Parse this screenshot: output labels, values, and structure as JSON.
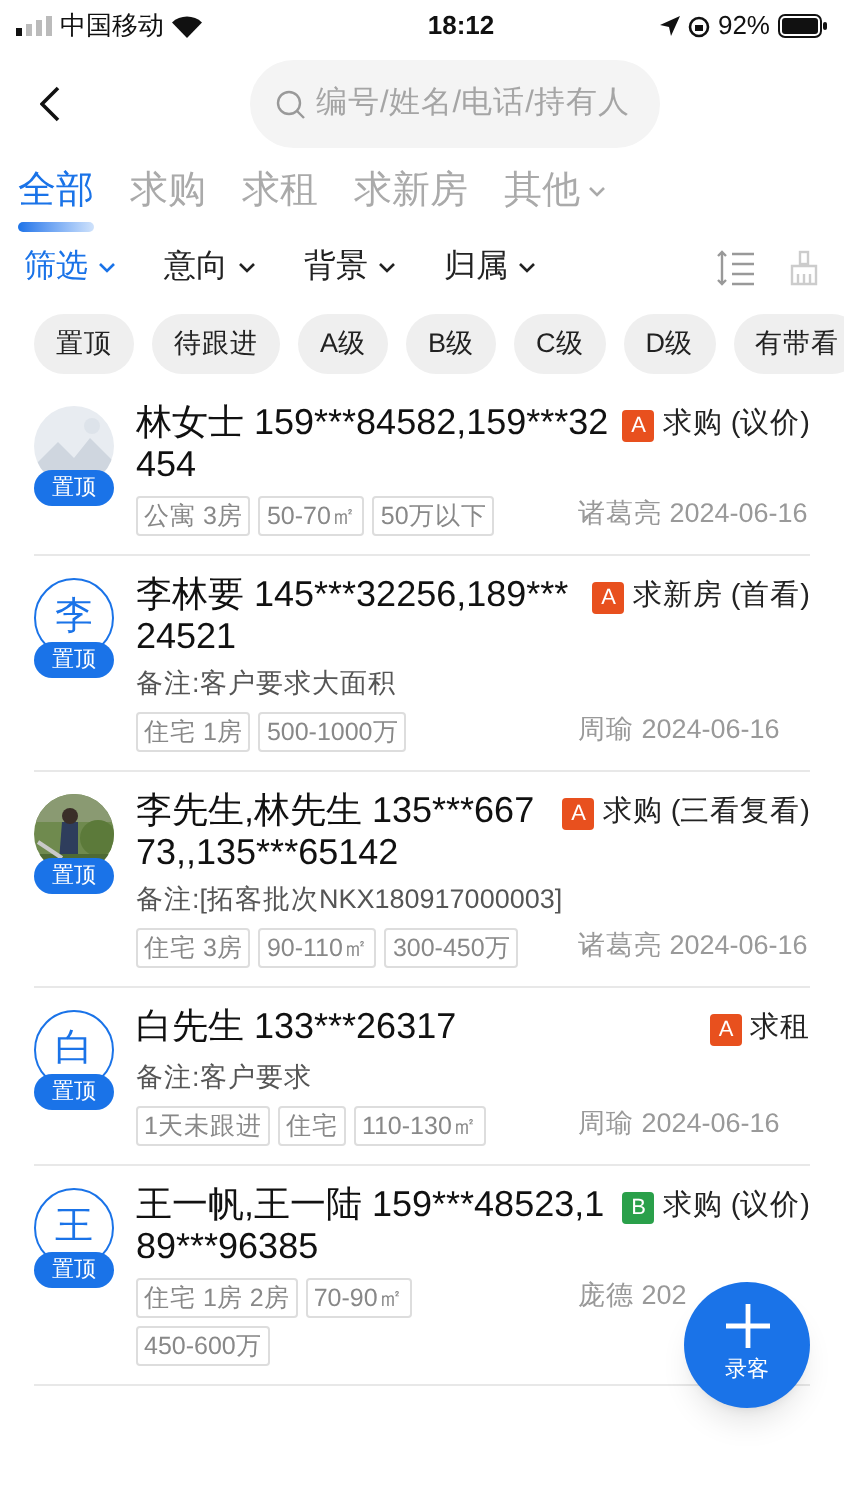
{
  "status_bar": {
    "carrier": "中国移动",
    "time": "18:12",
    "battery": "92%"
  },
  "search": {
    "placeholder": "编号/姓名/电话/持有人"
  },
  "tabs": [
    {
      "label": "全部",
      "selected": true
    },
    {
      "label": "求购",
      "selected": false
    },
    {
      "label": "求租",
      "selected": false
    },
    {
      "label": "求新房",
      "selected": false
    },
    {
      "label": "其他",
      "selected": false,
      "dropdown": true
    }
  ],
  "filters": [
    {
      "label": "筛选",
      "selected": true
    },
    {
      "label": "意向",
      "selected": false
    },
    {
      "label": "背景",
      "selected": false
    },
    {
      "label": "归属",
      "selected": false
    }
  ],
  "chips": [
    "置顶",
    "待跟进",
    "A级",
    "B级",
    "C级",
    "D级",
    "有带看"
  ],
  "clients": [
    {
      "avatar": {
        "kind": "placeholder"
      },
      "pinned": "置顶",
      "title": "林女士 159***84582,159***32454",
      "level": "A",
      "color": "#e8501e",
      "intent": "求购 (议价)",
      "tags": [
        "公寓 3房",
        "50-70㎡",
        "50万以下"
      ],
      "agent": "诸葛亮 2024-06-16"
    },
    {
      "avatar": {
        "kind": "letter",
        "letter": "李"
      },
      "pinned": "置顶",
      "title": "李林要 145***32256,189***24521",
      "level": "A",
      "color": "#e8501e",
      "intent": "求新房 (首看)",
      "note": "备注:客户要求大面积",
      "tags": [
        "住宅 1房",
        "500-1000万"
      ],
      "agent": "周瑜 2024-06-16"
    },
    {
      "avatar": {
        "kind": "picture"
      },
      "pinned": "置顶",
      "title": "李先生,林先生 135***66773,,135***65142",
      "level": "A",
      "color": "#e8501e",
      "intent": "求购 (三看复看)",
      "note": "备注:[拓客批次NKX180917000003]",
      "tags": [
        "住宅 3房",
        "90-110㎡",
        "300-450万"
      ],
      "agent": "诸葛亮 2024-06-16"
    },
    {
      "avatar": {
        "kind": "letter",
        "letter": "白"
      },
      "pinned": "置顶",
      "title": "白先生 133***26317",
      "level": "A",
      "color": "#e8501e",
      "intent": "求租",
      "note": "备注:客户要求",
      "tags": [
        "1天未跟进",
        "住宅",
        "110-130㎡"
      ],
      "agent": "周瑜 2024-06-16"
    },
    {
      "avatar": {
        "kind": "letter",
        "letter": "王"
      },
      "pinned": "置顶",
      "title": "王一帆,王一陆 159***48523,189***96385",
      "level": "B",
      "color": "#2aa04a",
      "intent": "求购 (议价)",
      "tags": [
        "住宅 1房 2房",
        "70-90㎡",
        "450-600万"
      ],
      "agent": "庞德 202"
    }
  ],
  "fab": {
    "label": "录客"
  }
}
